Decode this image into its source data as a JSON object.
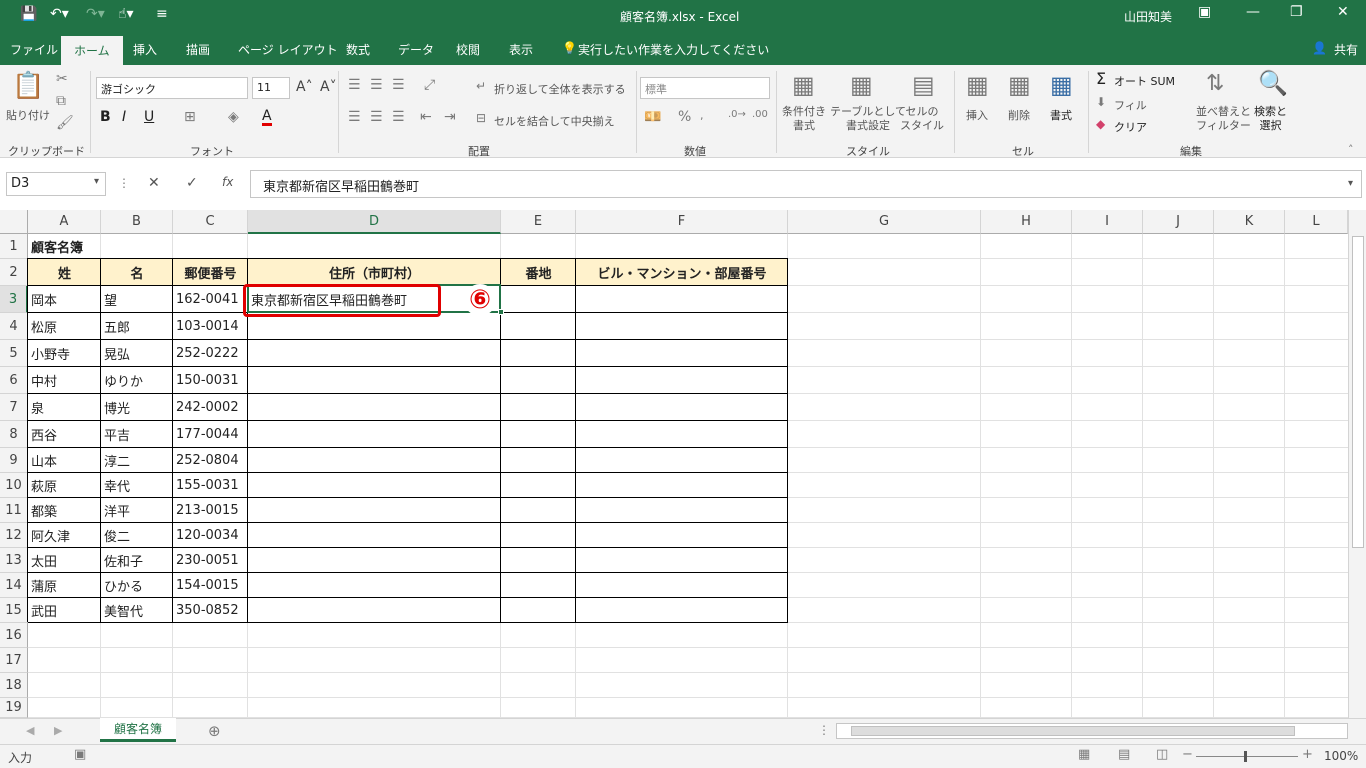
{
  "window": {
    "title": "顧客名簿.xlsx  -  Excel",
    "user": "山田知美"
  },
  "tabs": [
    "ファイル",
    "ホーム",
    "挿入",
    "描画",
    "ページ レイアウト",
    "数式",
    "データ",
    "校閲",
    "表示"
  ],
  "tell_me": "実行したい作業を入力してください",
  "share": "共有",
  "ribbon": {
    "clipboard": {
      "paste": "貼り付け",
      "group": "クリップボード"
    },
    "font": {
      "name": "游ゴシック",
      "size": "11",
      "bold": "B",
      "italic": "I",
      "underline": "U",
      "group": "フォント"
    },
    "alignment": {
      "wrap": "折り返して全体を表示する",
      "merge": "セルを結合して中央揃え",
      "group": "配置"
    },
    "number": {
      "format": "標準",
      "percent": "%",
      "group": "数値"
    },
    "styles": {
      "conditional": "条件付き\n書式",
      "table": "テーブルとして\n書式設定",
      "cell_styles": "セルの\nスタイル",
      "group": "スタイル"
    },
    "cells": {
      "insert": "挿入",
      "delete": "削除",
      "format": "書式",
      "group": "セル"
    },
    "editing": {
      "autosum": "オート SUM",
      "fill": "フィル",
      "clear": "クリア",
      "sort": "並べ替えと\nフィルター",
      "find": "検索と\n選択",
      "group": "編集"
    }
  },
  "formula_bar": {
    "name_box": "D3",
    "fx": "fx",
    "value": "東京都新宿区早稲田鶴巻町"
  },
  "columns": [
    "A",
    "B",
    "C",
    "D",
    "E",
    "F",
    "G",
    "H",
    "I",
    "J",
    "K",
    "L"
  ],
  "rows": [
    "1",
    "2",
    "3",
    "4",
    "5",
    "6",
    "7",
    "8",
    "9",
    "10",
    "11",
    "12",
    "13",
    "14",
    "15",
    "16",
    "17",
    "18",
    "19"
  ],
  "sheet": {
    "title": "顧客名簿",
    "headers": [
      "姓",
      "名",
      "郵便番号",
      "住所（市町村）",
      "番地",
      "ビル・マンション・部屋番号"
    ],
    "data": [
      [
        "岡本",
        "望",
        "162-0041",
        "東京都新宿区早稲田鶴巻町"
      ],
      [
        "松原",
        "五郎",
        "103-0014",
        ""
      ],
      [
        "小野寺",
        "晃弘",
        "252-0222",
        ""
      ],
      [
        "中村",
        "ゆりか",
        "150-0031",
        ""
      ],
      [
        "泉",
        "博光",
        "242-0002",
        ""
      ],
      [
        "西谷",
        "平吉",
        "177-0044",
        ""
      ],
      [
        "山本",
        "淳二",
        "252-0804",
        ""
      ],
      [
        "萩原",
        "幸代",
        "155-0031",
        ""
      ],
      [
        "都築",
        "洋平",
        "213-0015",
        ""
      ],
      [
        "阿久津",
        "俊二",
        "120-0034",
        ""
      ],
      [
        "太田",
        "佐和子",
        "230-0051",
        ""
      ],
      [
        "蒲原",
        "ひかる",
        "154-0015",
        ""
      ],
      [
        "武田",
        "美智代",
        "350-0852",
        ""
      ]
    ]
  },
  "annotation": {
    "marker": "⑥"
  },
  "sheet_tab": "顧客名簿",
  "status": {
    "mode": "入力",
    "zoom": "100%"
  },
  "colors": {
    "excel_green": "#217346",
    "header_fill": "#fff2cc",
    "highlight_red": "#e00000"
  }
}
